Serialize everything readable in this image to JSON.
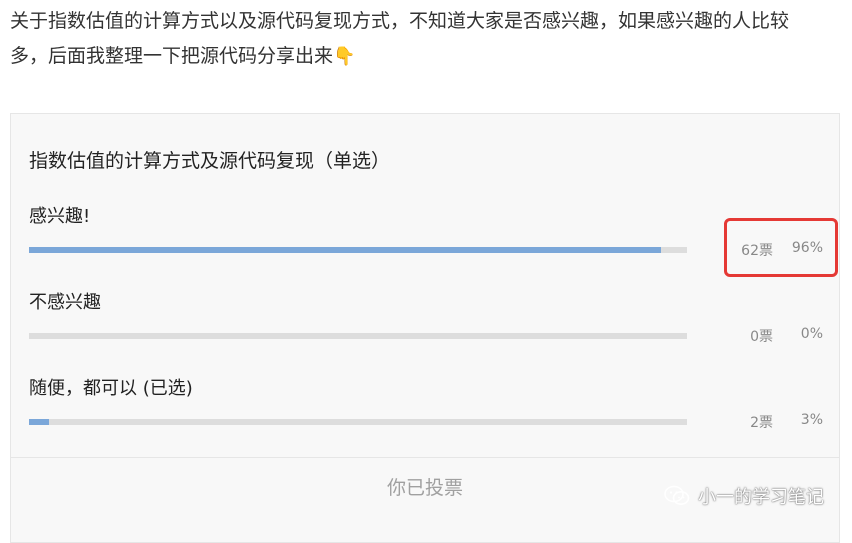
{
  "intro": {
    "line1": "关于指数估值的计算方式以及源代码复现方式，不知道大家是否感兴趣，如果感兴趣的人比较",
    "line2": "多，后面我整理一下把源代码分享出来",
    "emoji": "👇"
  },
  "poll": {
    "title": "指数估值的计算方式及源代码复现（单选）",
    "options": [
      {
        "label": "感兴趣!",
        "votes": "62票",
        "percent": "96%",
        "fill_fraction": 0.96,
        "bar_color": "#7ba7d9"
      },
      {
        "label": "不感兴趣",
        "votes": "0票",
        "percent": "0%",
        "fill_fraction": 0.0,
        "bar_color": "#7ba7d9"
      },
      {
        "label": "随便，都可以 (已选)",
        "votes": "2票",
        "percent": "3%",
        "fill_fraction": 0.03,
        "bar_color": "#7ba7d9"
      }
    ],
    "status_button": "你已投票"
  },
  "annotation": {
    "highlight_color": "#e53935"
  },
  "watermark": {
    "icon": "wechat-icon",
    "text": "小一的学习笔记"
  }
}
